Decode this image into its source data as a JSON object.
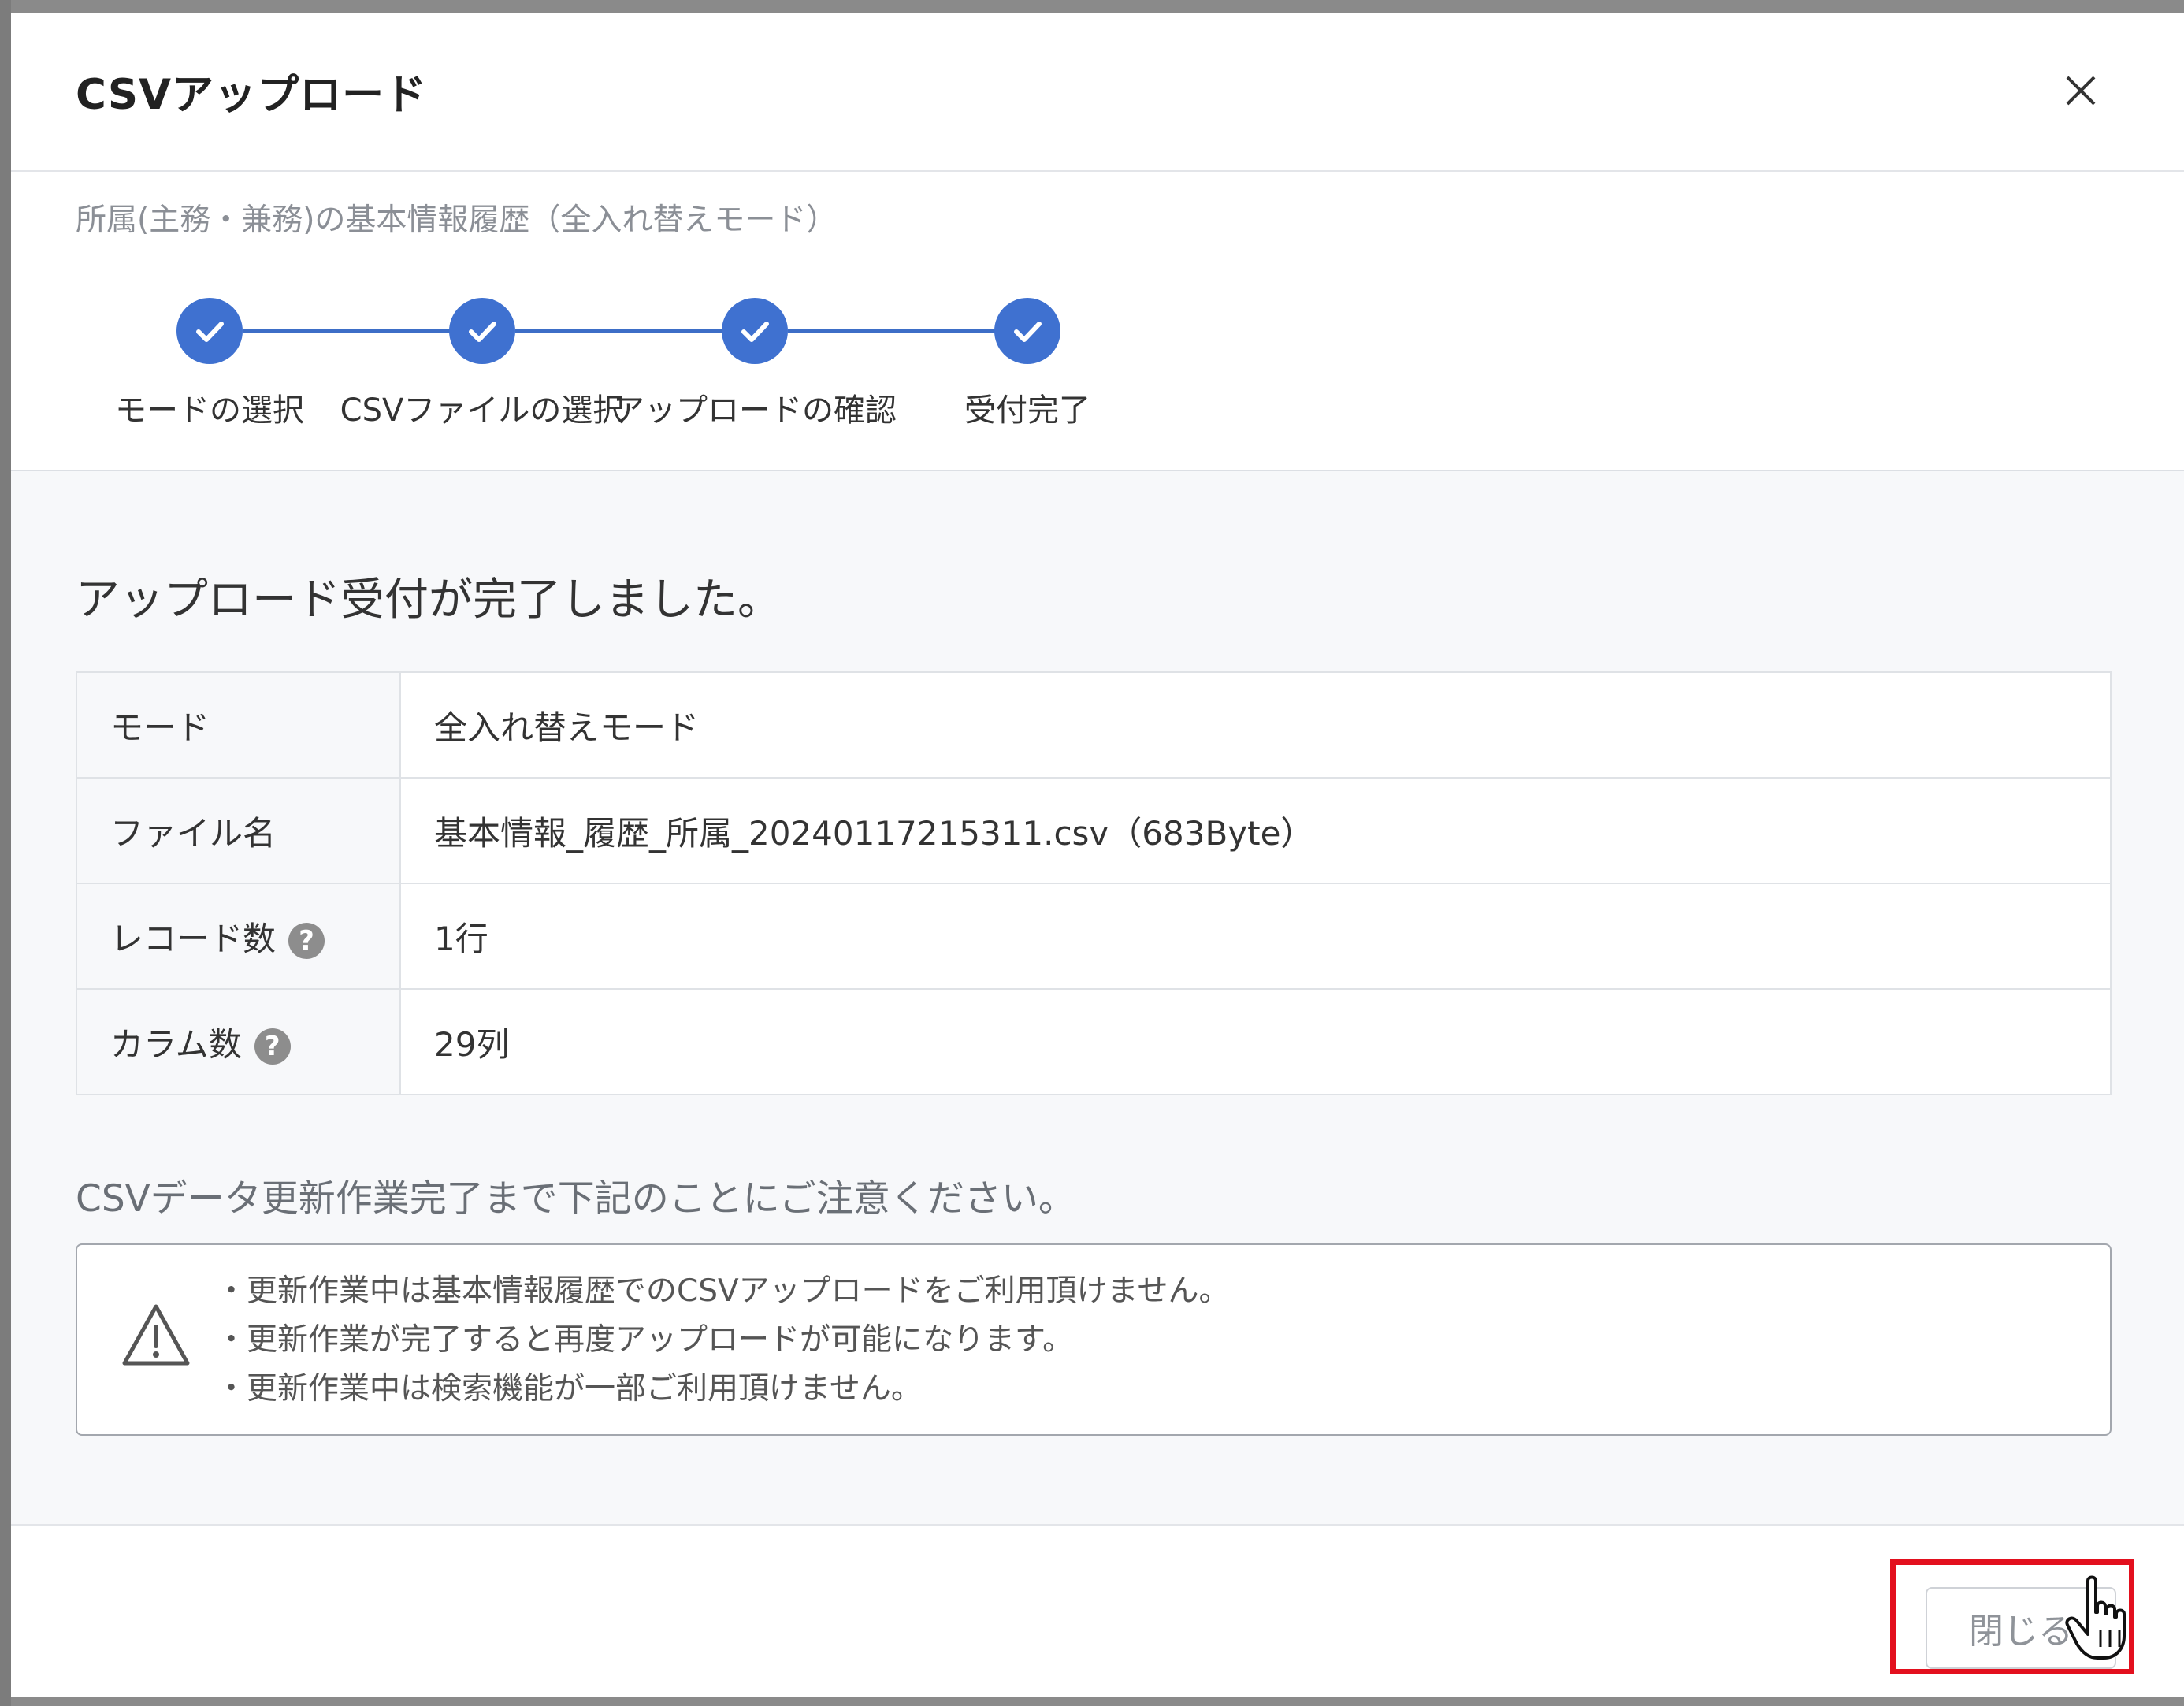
{
  "modal": {
    "title": "CSVアップロード",
    "subtitle": "所属(主務・兼務)の基本情報履歴（全入れ替えモード）"
  },
  "steps": [
    {
      "label": "モードの選択",
      "status": "completed"
    },
    {
      "label": "CSVファイルの選択",
      "status": "completed"
    },
    {
      "label": "アップロードの確認",
      "status": "completed"
    },
    {
      "label": "受付完了",
      "status": "completed"
    }
  ],
  "result": {
    "heading": "アップロード受付が完了しました。",
    "rows": [
      {
        "key": "モード",
        "value": "全入れ替えモード",
        "help": false
      },
      {
        "key": "ファイル名",
        "value": "基本情報_履歴_所属_20240117215311.csv（683Byte）",
        "help": false
      },
      {
        "key": "レコード数",
        "value": "1行",
        "help": true
      },
      {
        "key": "カラム数",
        "value": "29列",
        "help": true
      }
    ]
  },
  "notice": {
    "heading": "CSVデータ更新作業完了まで下記のことにご注意ください。",
    "lines": [
      "・更新作業中は基本情報履歴でのCSVアップロードをご利用頂けません。",
      "・更新作業が完了すると再度アップロードが可能になります。",
      "・更新作業中は検索機能が一部ご利用頂けません。"
    ]
  },
  "footer": {
    "close_label": "閉じる"
  },
  "icons": {
    "close": "close-icon",
    "step": "check-icon",
    "help": "help-icon",
    "warning": "warning-icon",
    "cursor": "hand-cursor-icon"
  },
  "colors": {
    "accent": "#3f71d0",
    "highlight": "#e3101e"
  }
}
